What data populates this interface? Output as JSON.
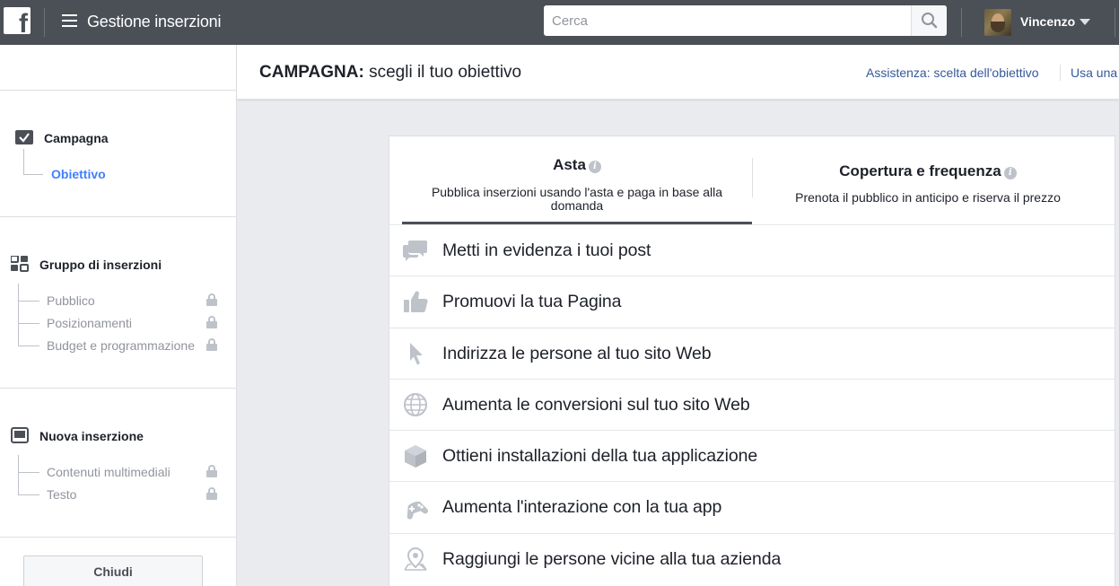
{
  "topbar": {
    "logo_letter": "f",
    "app_title": "Gestione inserzioni",
    "search_placeholder": "Cerca",
    "user_name": "Vincenzo"
  },
  "sidebar": {
    "campaign": {
      "title": "Campagna",
      "items": [
        {
          "label": "Obiettivo",
          "active": true
        }
      ]
    },
    "adset": {
      "title": "Gruppo di inserzioni",
      "items": [
        {
          "label": "Pubblico",
          "locked": true
        },
        {
          "label": "Posizionamenti",
          "locked": true
        },
        {
          "label": "Budget e programmazione",
          "locked": true
        }
      ]
    },
    "ad": {
      "title": "Nuova inserzione",
      "items": [
        {
          "label": "Contenuti multimediali",
          "locked": true
        },
        {
          "label": "Testo",
          "locked": true
        }
      ]
    },
    "close_label": "Chiudi"
  },
  "header": {
    "title_bold": "CAMPAGNA:",
    "title_rest": " scegli il tuo obiettivo",
    "help_link": "Assistenza: scelta dell'obiettivo",
    "use_link": "Usa una"
  },
  "buying_tabs": [
    {
      "title": "Asta",
      "description": "Pubblica inserzioni usando l'asta e paga in base alla domanda",
      "active": true
    },
    {
      "title": "Copertura e frequenza",
      "description": "Prenota il pubblico in anticipo e riserva il prezzo",
      "active": false
    }
  ],
  "objectives": [
    {
      "label": "Metti in evidenza i tuoi post",
      "icon": "speech-bubbles-icon"
    },
    {
      "label": "Promuovi la tua Pagina",
      "icon": "thumbs-up-icon"
    },
    {
      "label": "Indirizza le persone al tuo sito Web",
      "icon": "cursor-icon"
    },
    {
      "label": "Aumenta le conversioni sul tuo sito Web",
      "icon": "globe-icon"
    },
    {
      "label": "Ottieni installazioni della tua applicazione",
      "icon": "box-icon"
    },
    {
      "label": "Aumenta l'interazione con la tua app",
      "icon": "gamepad-icon"
    },
    {
      "label": "Raggiungi le persone vicine alla tua azienda",
      "icon": "map-pin-icon"
    }
  ],
  "colors": {
    "topbar": "#4b4f56",
    "link": "#365899",
    "active_sidebar": "#4080ff",
    "icon_gray": "#bec2c9",
    "background": "#e9ebee"
  }
}
